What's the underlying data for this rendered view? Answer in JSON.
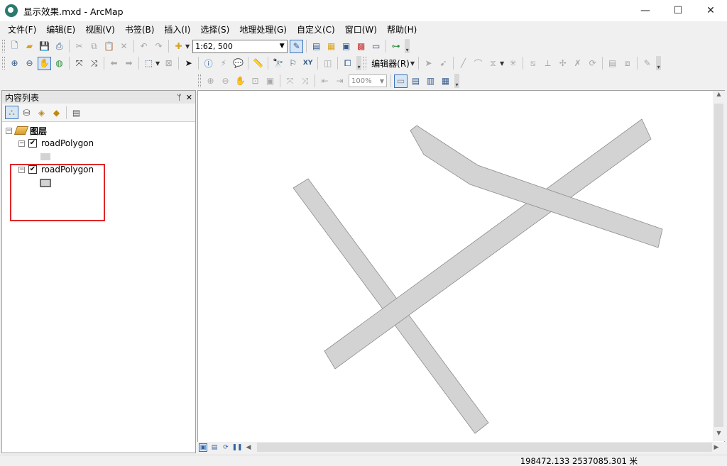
{
  "window": {
    "title": "显示效果.mxd - ArcMap",
    "minimize": "—",
    "maximize": "☐",
    "close": "✕"
  },
  "menu": [
    "文件(F)",
    "编辑(E)",
    "视图(V)",
    "书签(B)",
    "插入(I)",
    "选择(S)",
    "地理处理(G)",
    "自定义(C)",
    "窗口(W)",
    "帮助(H)"
  ],
  "toolbar": {
    "scale": "1:62, 500",
    "editor_label": "编辑器(R)",
    "zoom_percent": "100%"
  },
  "toc": {
    "title": "内容列表",
    "pin": "ᛘ",
    "close": "✕",
    "group_label": "图层",
    "layers": [
      {
        "name": "roadPolygon",
        "checked": "✔"
      },
      {
        "name": "roadPolygon",
        "checked": "✔"
      }
    ]
  },
  "colors": {
    "road_fill": "#d3d3d3",
    "road_stroke": "#8c8c8c",
    "highlight": "#e0262a"
  },
  "status": {
    "coordinates": "198472.133  2537085.301 米"
  }
}
